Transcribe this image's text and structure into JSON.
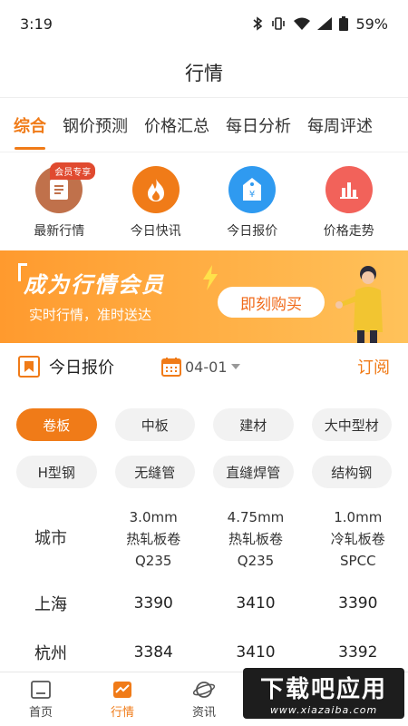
{
  "status_bar": {
    "time": "3:19",
    "battery": "59%"
  },
  "header": {
    "title": "行情"
  },
  "tabs": [
    {
      "label": "综合",
      "active": true
    },
    {
      "label": "钢价预测"
    },
    {
      "label": "价格汇总"
    },
    {
      "label": "每日分析"
    },
    {
      "label": "每周评述"
    }
  ],
  "quick_actions": [
    {
      "label": "最新行情",
      "icon": "document-icon",
      "color": "#c0714b",
      "badge": "会员专享"
    },
    {
      "label": "今日快讯",
      "icon": "flame-icon",
      "color": "#f07b18"
    },
    {
      "label": "今日报价",
      "icon": "price-tag-icon",
      "color": "#2f9af0"
    },
    {
      "label": "价格走势",
      "icon": "bar-chart-icon",
      "color": "#f2625a"
    }
  ],
  "banner": {
    "title": "成为行情会员",
    "subtitle": "实时行情，准时送达",
    "button": "即刻购买"
  },
  "today_price": {
    "title": "今日报价",
    "date": "04-01",
    "subscribe": "订阅"
  },
  "categories": [
    {
      "label": "卷板",
      "active": true
    },
    {
      "label": "中板"
    },
    {
      "label": "建材"
    },
    {
      "label": "大中型材"
    },
    {
      "label": "H型钢"
    },
    {
      "label": "无缝管"
    },
    {
      "label": "直缝焊管"
    },
    {
      "label": "结构钢"
    }
  ],
  "price_table": {
    "city_header": "城市",
    "columns": [
      {
        "spec": "3.0mm",
        "name": "热轧板卷",
        "grade": "Q235"
      },
      {
        "spec": "4.75mm",
        "name": "热轧板卷",
        "grade": "Q235"
      },
      {
        "spec": "1.0mm",
        "name": "冷轧板卷",
        "grade": "SPCC"
      }
    ],
    "rows": [
      {
        "city": "上海",
        "values": [
          "3390",
          "3410",
          "3390"
        ],
        "trend": [
          "up",
          "flat",
          "up"
        ]
      },
      {
        "city": "杭州",
        "values": [
          "3384",
          "3410",
          "3392"
        ],
        "trend": [
          "down",
          "flat",
          "down"
        ]
      }
    ]
  },
  "bottom_nav": [
    {
      "label": "首页",
      "icon": "home-icon"
    },
    {
      "label": "行情",
      "icon": "trend-icon",
      "active": true
    },
    {
      "label": "资讯",
      "icon": "planet-icon"
    }
  ],
  "watermark": {
    "big": "下载吧应用",
    "small": "www.xiazaiba.com"
  },
  "colors": {
    "accent": "#f07b18",
    "up": "#e23a2e",
    "down": "#1f9a3a"
  }
}
